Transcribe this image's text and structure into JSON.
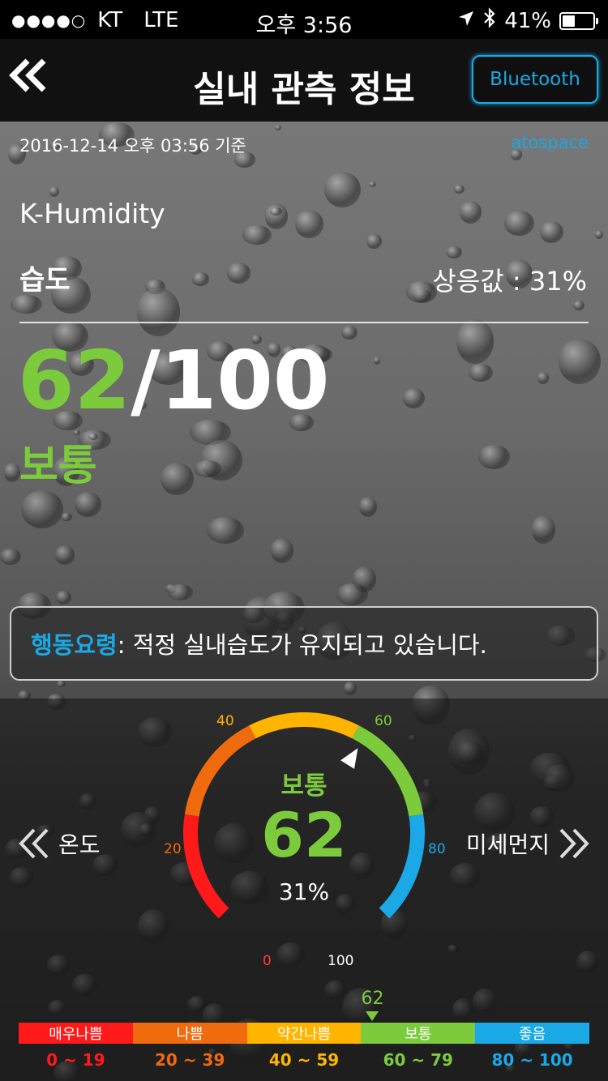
{
  "status_bar": {
    "signal": "●●●●○",
    "carrier": "KT",
    "network": "LTE",
    "time": "오후 3:56",
    "battery": "41%",
    "battery_level": 0.41
  },
  "header": {
    "title": "실내 관측 정보",
    "bluetooth_label": "Bluetooth"
  },
  "info": {
    "timestamp": "2016-12-14 오후 03:56 기준",
    "brand": "atospace",
    "index_name": "K-Humidity",
    "measure": "습도",
    "corresponding": "상응값 : 31%",
    "score_value": "62",
    "score_max": "/100",
    "status": "보통"
  },
  "advice": {
    "label": "행동요령",
    "text": " : 적정 실내습도가 유지되고 있습니다."
  },
  "gauge": {
    "state": "보통",
    "value": "62",
    "percent": "31%",
    "score": 62,
    "ticks": [
      "0",
      "20",
      "40",
      "60",
      "80",
      "100"
    ],
    "prev_label": "온도",
    "next_label": "미세먼지"
  },
  "legend": {
    "marker": "62",
    "segments": [
      {
        "label": "매우나쁨",
        "range": "0 ~ 19",
        "color": "#ff1a1a"
      },
      {
        "label": "나쁨",
        "range": "20 ~ 39",
        "color": "#f06a0e"
      },
      {
        "label": "약간나쁨",
        "range": "40 ~ 59",
        "color": "#ffb400"
      },
      {
        "label": "보통",
        "range": "60 ~ 79",
        "color": "#7ccb3d"
      },
      {
        "label": "좋음",
        "range": "80 ~ 100",
        "color": "#1aa9e6"
      }
    ]
  }
}
